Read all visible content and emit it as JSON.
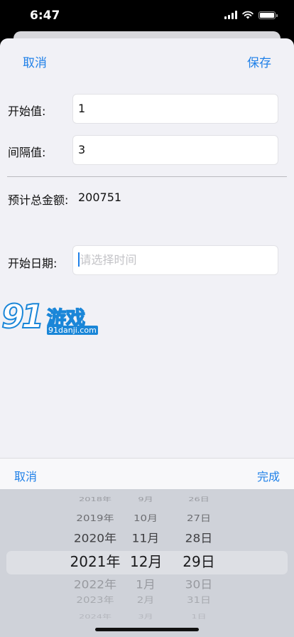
{
  "status_bar": {
    "time": "6:47"
  },
  "nav": {
    "cancel_label": "取消",
    "save_label": "保存"
  },
  "form": {
    "start_value": {
      "label": "开始值:",
      "value": "1"
    },
    "interval_value": {
      "label": "间隔值:",
      "value": "3"
    },
    "estimated_total": {
      "label": "预计总金额:",
      "value": "200751"
    },
    "start_date": {
      "label": "开始日期:",
      "placeholder": "请选择时间"
    }
  },
  "watermark": {
    "number": "91",
    "text": "游戏",
    "url": "91danji.com"
  },
  "picker_toolbar": {
    "cancel_label": "取消",
    "done_label": "完成"
  },
  "date_picker": {
    "years": [
      "2018年",
      "2019年",
      "2020年",
      "2021年",
      "2022年",
      "2023年",
      "2024年"
    ],
    "months": [
      "9月",
      "10月",
      "11月",
      "12月",
      "1月",
      "2月",
      "3月"
    ],
    "days": [
      "26日",
      "27日",
      "28日",
      "29日",
      "30日",
      "31日",
      "1日"
    ],
    "selected": {
      "year": "2021年",
      "month": "12月",
      "day": "29日"
    }
  },
  "colors": {
    "accent": "#1f80e8",
    "sheet_background": "#f1f1f6",
    "picker_background": "#cfd2d9"
  }
}
